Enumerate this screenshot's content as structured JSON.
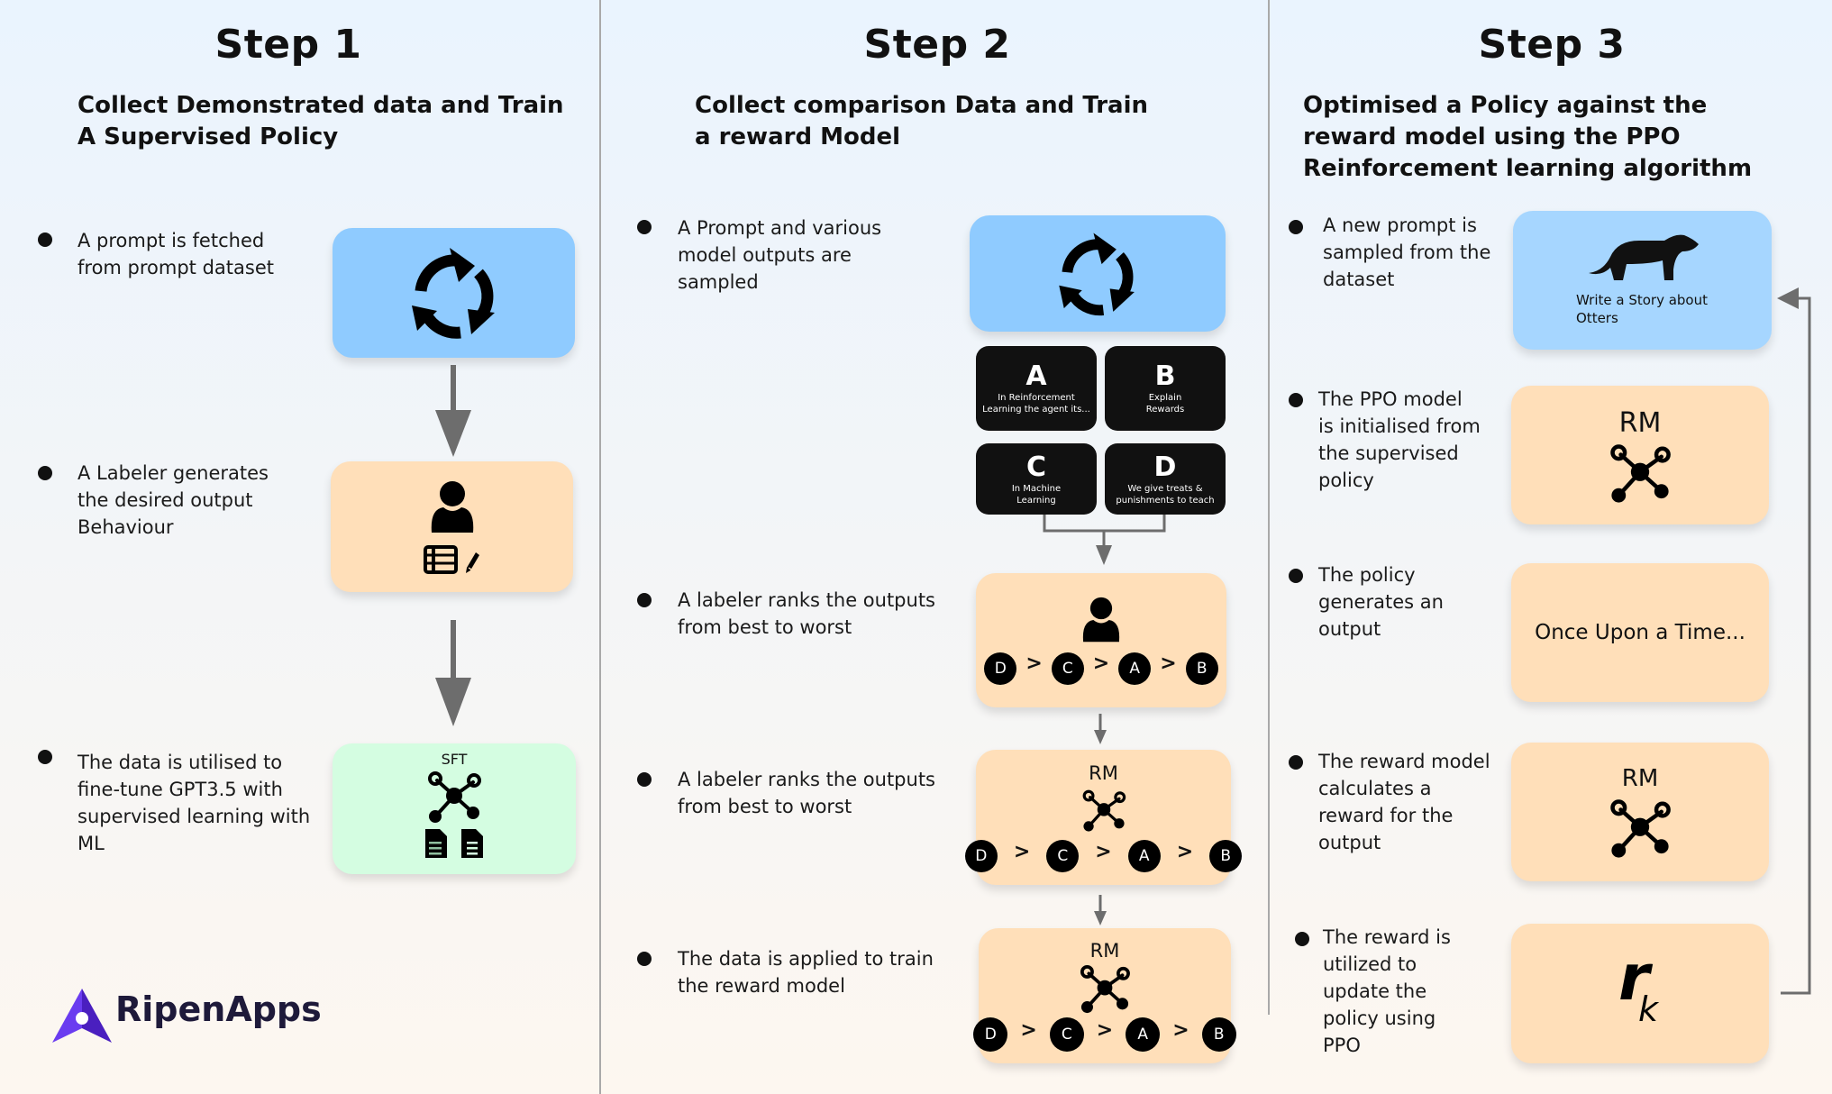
{
  "colors": {
    "prompt_card": "#8fcbff",
    "prompt_card_step3": "#a6d6ff",
    "model_card": "#ffdfb9",
    "sft_card": "#d4fde1",
    "output_box": "#111111",
    "arrow": "#6d6d6d",
    "brand": "#5b2fd6"
  },
  "steps": [
    {
      "title": "Step 1",
      "subtitle": "Collect Demonstrated data and Train A Supervised Policy",
      "bullets": [
        "A prompt is fetched from prompt dataset",
        "A Labeler generates the desired output Behaviour",
        "The data is utilised to fine-tune GPT3.5 with supervised learning with ML"
      ],
      "cards": {
        "prompt_icon": "recycle-icon",
        "labeler_icons": [
          "user-icon",
          "table-icon",
          "pencil-icon"
        ],
        "sft_label": "SFT",
        "sft_icons": [
          "network-icon",
          "document-icon",
          "document-icon"
        ]
      }
    },
    {
      "title": "Step 2",
      "subtitle": "Collect comparison Data and Train a reward Model",
      "bullets": [
        "A Prompt and various model outputs are sampled",
        "A labeler ranks the outputs from best to worst",
        "A labeler ranks the outputs from best to worst",
        "The data is applied to train the reward model"
      ],
      "outputs": [
        {
          "letter": "A",
          "text": "In Reinforcement Learning the agent its..."
        },
        {
          "letter": "B",
          "text": "Explain Rewards"
        },
        {
          "letter": "C",
          "text": "In Machine Learning"
        },
        {
          "letter": "D",
          "text": "We give treats & punishments to teach"
        }
      ],
      "ranking": [
        "D",
        "C",
        "A",
        "B"
      ],
      "ranking_separator": ">",
      "rm_label": "RM"
    },
    {
      "title": "Step 3",
      "subtitle": "Optimised a Policy against the reward model using the PPO Reinforcement learning algorithm",
      "bullets": [
        "A new prompt is sampled from the dataset",
        "The PPO model is initialised from the supervised policy",
        "The policy generates an output",
        "The reward model calculates a reward for the output",
        "The reward is utilized to update the policy using PPO"
      ],
      "prompt_text": "Write a Story about Otters",
      "rm_label": "RM",
      "output_text": "Once Upon a Time...",
      "reward_symbol": "r",
      "reward_subscript": "k"
    }
  ],
  "brand": {
    "name": "RipenApps"
  }
}
